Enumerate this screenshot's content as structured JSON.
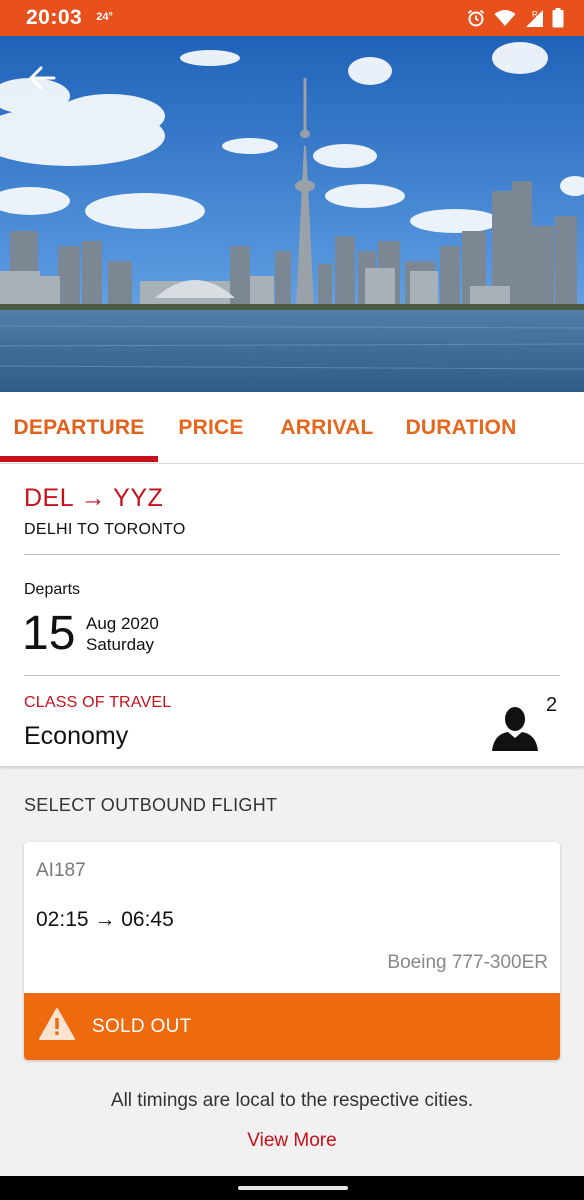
{
  "status_bar": {
    "time": "20:03",
    "temperature": "24°",
    "icons": [
      "alarm-icon",
      "wifi-icon",
      "signal-icon",
      "battery-icon"
    ]
  },
  "header": {
    "back_icon": "arrow-left-icon"
  },
  "tabs": [
    {
      "label": "DEPARTURE",
      "active": true
    },
    {
      "label": "PRICE",
      "active": false
    },
    {
      "label": "ARRIVAL",
      "active": false
    },
    {
      "label": "DURATION",
      "active": false
    }
  ],
  "trip": {
    "route_code": "DEL → YYZ",
    "route_name": "DELHI TO TORONTO",
    "departs_label": "Departs",
    "day": "15",
    "month_year": "Aug 2020",
    "weekday": "Saturday",
    "class_label": "CLASS OF TRAVEL",
    "class_value": "Economy",
    "passenger_count": "2",
    "passenger_icon": "person-icon"
  },
  "outbound": {
    "title": "SELECT OUTBOUND FLIGHT",
    "flight": {
      "number": "AI187",
      "times": "02:15 → 06:45",
      "aircraft": "Boeing 777-300ER",
      "status": "SOLD OUT",
      "status_icon": "warning-icon"
    }
  },
  "footer": {
    "note": "All timings are local to the respective cities.",
    "view_more": "View More"
  },
  "colors": {
    "brand_orange": "#e8501c",
    "accent_red": "#c8101c",
    "sold_out": "#ee6a0f",
    "tab_text": "#e8661c"
  }
}
